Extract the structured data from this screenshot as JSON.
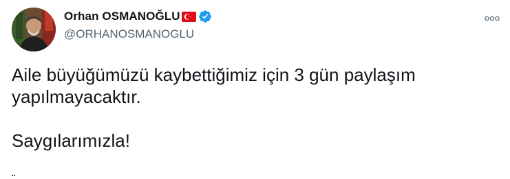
{
  "tweet": {
    "author": {
      "display_name": "Orhan OSMANOĞLU",
      "handle": "@ORHANOSMANOGLU",
      "verified": true,
      "flag_icon": "turkey-flag-icon",
      "verified_icon": "verified-badge-icon"
    },
    "more_icon": "more-options-icon",
    "text_lines": [
      "Aile büyüğümüzü kaybettiğimiz için 3 gün paylaşım",
      "yapılmayacaktır."
    ],
    "closing": "Saygılarımızla!"
  },
  "colors": {
    "text_primary": "#0f1419",
    "text_secondary": "#536471",
    "verified_blue": "#1d9bf0",
    "flag_red": "#e30a17"
  }
}
